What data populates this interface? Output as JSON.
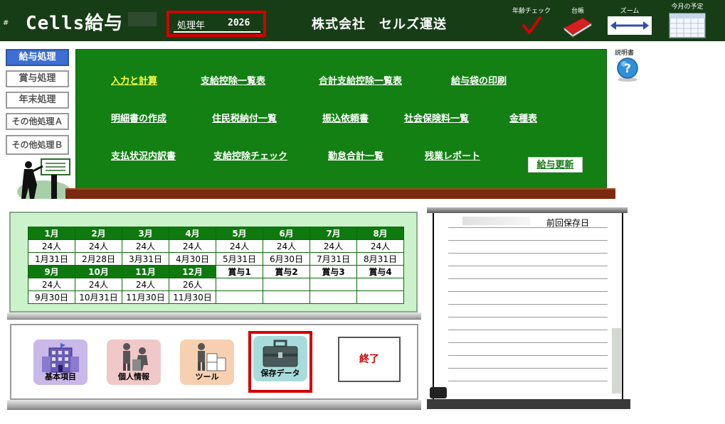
{
  "header": {
    "hash": "#",
    "app_title": "Cells給与",
    "year_label": "処理年",
    "year_value": "2026",
    "company": "株式会社　セルズ運送",
    "tools": {
      "age_check": "年齢チェック",
      "ledger": "台帳",
      "zoom": "ズーム",
      "month_schedule": "今月の予定"
    }
  },
  "side_menu": {
    "items": [
      {
        "label": "給与処理"
      },
      {
        "label": "賞与処理"
      },
      {
        "label": "年末処理"
      },
      {
        "label": "その他処理Ａ"
      },
      {
        "label": "その他処理Ｂ"
      }
    ]
  },
  "board": {
    "links": [
      "入力と計算",
      "支給控除一覧表",
      "合計支給控除一覧表",
      "給与袋の印刷",
      "明細書の作成",
      "住民税納付一覧",
      "振込依頼書",
      "社会保険料一覧",
      "金種表",
      "支払状況内訳書",
      "支給控除チェック",
      "勤怠合計一覧",
      "残業レポート"
    ],
    "update_button": "給与更新"
  },
  "help": {
    "label": "説明書"
  },
  "calendar": {
    "row1": {
      "months": [
        "1月",
        "2月",
        "3月",
        "4月",
        "5月",
        "6月",
        "7月",
        "8月"
      ],
      "counts": [
        "24人",
        "24人",
        "24人",
        "24人",
        "24人",
        "24人",
        "24人",
        "24人"
      ],
      "dates": [
        "1月31日",
        "2月28日",
        "3月31日",
        "4月30日",
        "5月31日",
        "6月30日",
        "7月31日",
        "8月31日"
      ]
    },
    "row2": {
      "months": [
        "9月",
        "10月",
        "11月",
        "12月",
        "賞与1",
        "賞与2",
        "賞与3",
        "賞与4"
      ],
      "counts": [
        "24人",
        "24人",
        "24人",
        "26人",
        "",
        "",
        "",
        ""
      ],
      "dates": [
        "9月30日",
        "10月31日",
        "11月30日",
        "11月30日",
        "",
        "",
        "",
        ""
      ]
    }
  },
  "tools": {
    "basic": "基本項目",
    "personal": "個人情報",
    "tool": "ツール",
    "save_data": "保存データ",
    "exit": "終了"
  },
  "notebook": {
    "caption": "前回保存日"
  },
  "colors": {
    "header_bg": "#173d17",
    "board_green": "#128012",
    "highlight_red": "#d40000",
    "active_blue": "#3d6fd4"
  }
}
